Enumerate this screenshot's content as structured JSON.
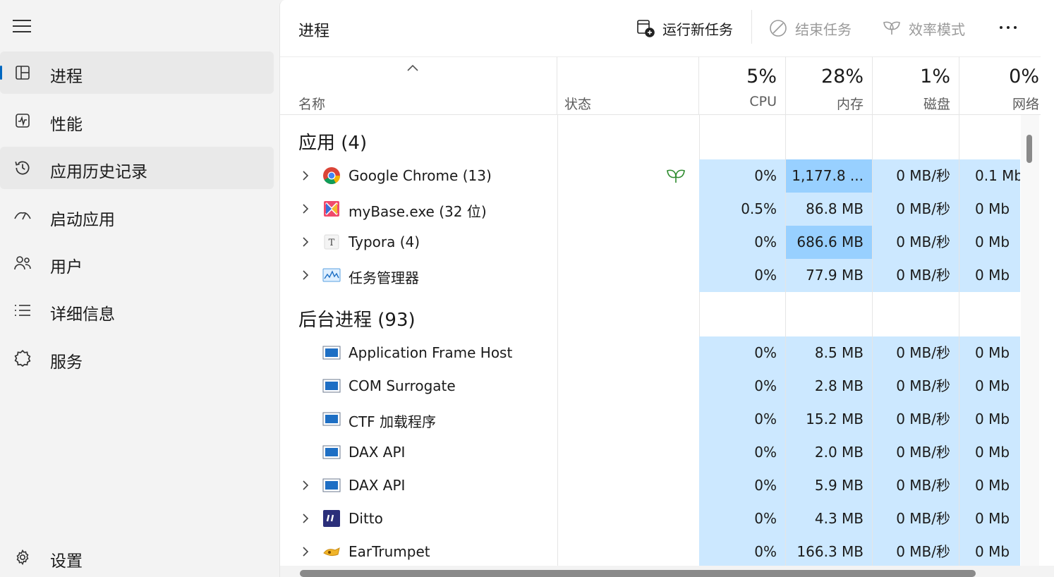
{
  "sidebar": {
    "items": [
      {
        "label": "进程",
        "icon": "processes-icon"
      },
      {
        "label": "性能",
        "icon": "performance-icon"
      },
      {
        "label": "应用历史记录",
        "icon": "app-history-icon"
      },
      {
        "label": "启动应用",
        "icon": "startup-apps-icon"
      },
      {
        "label": "用户",
        "icon": "users-icon"
      },
      {
        "label": "详细信息",
        "icon": "details-icon"
      },
      {
        "label": "服务",
        "icon": "services-icon"
      }
    ],
    "settings_label": "设置"
  },
  "header": {
    "title": "进程",
    "run_new_task": "运行新任务",
    "end_task": "结束任务",
    "efficiency_mode": "效率模式"
  },
  "columns": {
    "name": "名称",
    "status": "状态",
    "cpu": {
      "percent": "5%",
      "label": "CPU"
    },
    "memory": {
      "percent": "28%",
      "label": "内存"
    },
    "disk": {
      "percent": "1%",
      "label": "磁盘"
    },
    "network": {
      "percent": "0%",
      "label": "网络"
    }
  },
  "groups": {
    "apps_title": "应用 (4)",
    "background_title": "后台进程 (93)"
  },
  "apps": [
    {
      "name": "Google Chrome (13)",
      "cpu": "0%",
      "memory": "1,177.8 ...",
      "disk": "0 MB/秒",
      "network": "0.1 Mb"
    },
    {
      "name": "myBase.exe (32 位)",
      "cpu": "0.5%",
      "memory": "86.8 MB",
      "disk": "0 MB/秒",
      "network": "0 Mb"
    },
    {
      "name": "Typora (4)",
      "cpu": "0%",
      "memory": "686.6 MB",
      "disk": "0 MB/秒",
      "network": "0 Mb"
    },
    {
      "name": "任务管理器",
      "cpu": "0%",
      "memory": "77.9 MB",
      "disk": "0 MB/秒",
      "network": "0 Mb"
    }
  ],
  "background": [
    {
      "name": "Application Frame Host",
      "cpu": "0%",
      "memory": "8.5 MB",
      "disk": "0 MB/秒",
      "network": "0 Mb"
    },
    {
      "name": "COM Surrogate",
      "cpu": "0%",
      "memory": "2.8 MB",
      "disk": "0 MB/秒",
      "network": "0 Mb"
    },
    {
      "name": "CTF 加载程序",
      "cpu": "0%",
      "memory": "15.2 MB",
      "disk": "0 MB/秒",
      "network": "0 Mb"
    },
    {
      "name": "DAX API",
      "cpu": "0%",
      "memory": "2.0 MB",
      "disk": "0 MB/秒",
      "network": "0 Mb"
    },
    {
      "name": "DAX API",
      "cpu": "0%",
      "memory": "5.9 MB",
      "disk": "0 MB/秒",
      "network": "0 Mb"
    },
    {
      "name": "Ditto",
      "cpu": "0%",
      "memory": "4.3 MB",
      "disk": "0 MB/秒",
      "network": "0 Mb"
    },
    {
      "name": "EarTrumpet",
      "cpu": "0%",
      "memory": "166.3 MB",
      "disk": "0 MB/秒",
      "network": "0 Mb"
    }
  ],
  "colors": {
    "accent": "#0067c0",
    "cell_light": "#cce8ff",
    "cell_heavy": "#98d0ff",
    "efficiency_leaf": "#2e8b2e"
  }
}
